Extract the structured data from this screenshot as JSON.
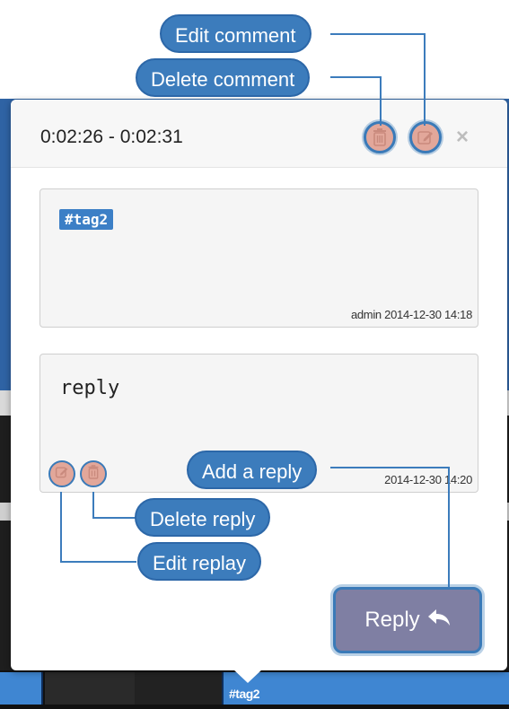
{
  "popover": {
    "time_range": "0:02:26 - 0:02:31",
    "close_glyph": "×"
  },
  "comment": {
    "tag": "#tag2",
    "author_time": "admin 2014-12-30 14:18"
  },
  "reply": {
    "text": "reply",
    "author_time": "2014-12-30 14:20"
  },
  "reply_button": {
    "label": "Reply",
    "icon": "reply-arrow-icon"
  },
  "timeline": {
    "tag_label": "#tag2"
  },
  "callouts": {
    "edit_comment": "Edit comment",
    "delete_comment": "Delete comment",
    "add_reply": "Add a reply",
    "delete_reply": "Delete reply",
    "edit_reply": "Edit replay"
  },
  "colors": {
    "callout": "#3c7cbc",
    "accent": "#3a7ab8",
    "icon_fill": "#e2a79a",
    "reply_button": "#7f7fa3",
    "tag": "#3c7fc6"
  }
}
